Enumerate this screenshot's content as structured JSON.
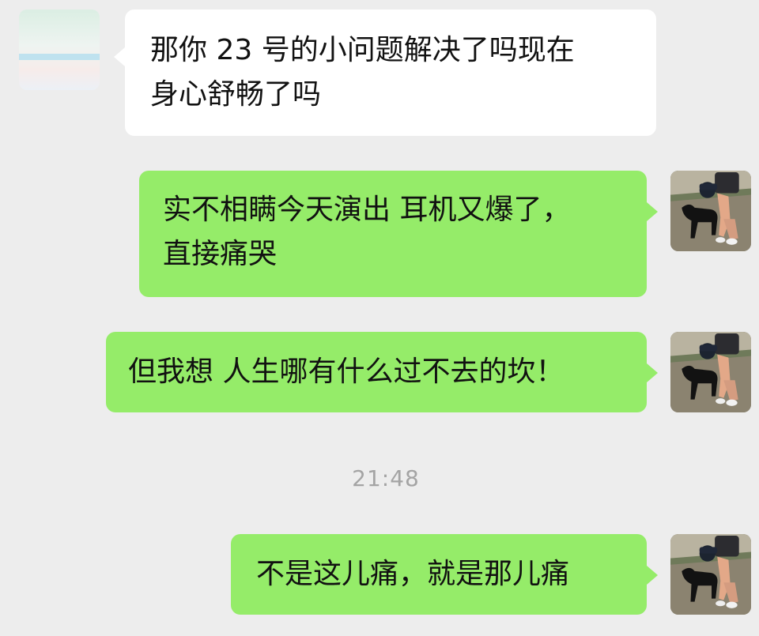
{
  "messages": [
    {
      "sender": "friend",
      "lines": [
        "那你 23 号的小问题解决了吗现在",
        "身心舒畅了吗"
      ]
    },
    {
      "sender": "self",
      "lines": [
        "实不相瞒今天演出 耳机又爆了，",
        "直接痛哭"
      ]
    },
    {
      "sender": "self",
      "lines": [
        "但我想 人生哪有什么过不去的坎！"
      ]
    },
    {
      "sender": "self",
      "lines": [
        "不是这儿痛，就是那儿痛"
      ]
    }
  ],
  "timestamp": "21:48",
  "colors": {
    "background": "#ededed",
    "incoming_bubble": "#ffffff",
    "outgoing_bubble": "#95ec69",
    "timestamp_text": "#a4a4a4"
  },
  "icons": {
    "friend_avatar": "pastel-gradient-avatar",
    "self_avatar": "person-with-black-dog-photo"
  }
}
